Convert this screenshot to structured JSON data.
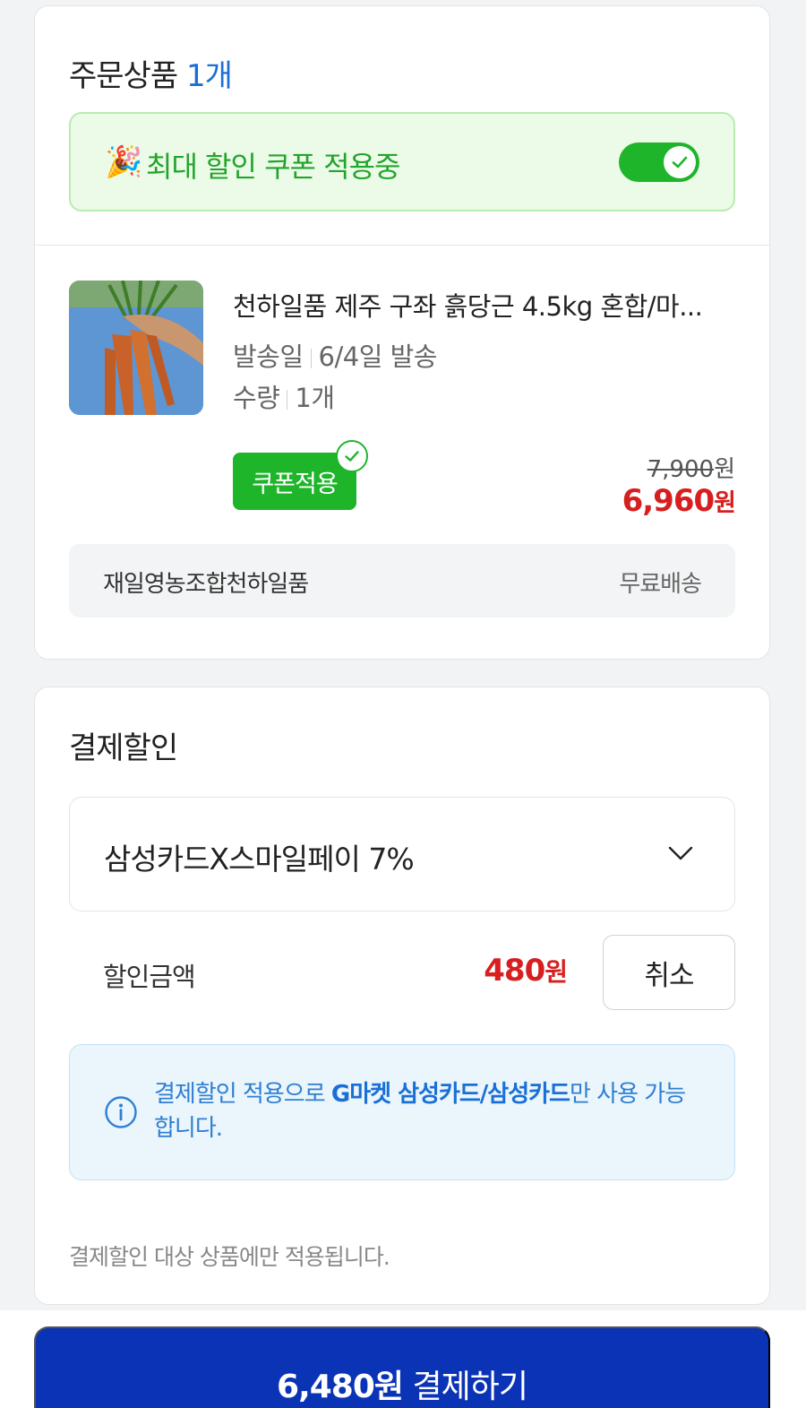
{
  "order": {
    "title": "주문상품",
    "count": "1개",
    "coupon_banner": {
      "emoji": "🎉",
      "text": "최대 할인 쿠폰 적용중",
      "toggle_on": true
    },
    "product": {
      "name": "천하일품 제주 구좌 흙당근 4.5kg 혼합/마...",
      "ship_label": "발송일",
      "ship_value": "6/4일 발송",
      "qty_label": "수량",
      "qty_value": "1개",
      "coupon_chip": "쿠폰적용",
      "price_original": "7,900",
      "price_original_unit": "원",
      "price_final": "6,960",
      "price_final_unit": "원"
    },
    "seller": {
      "name": "재일영농조합천하일품",
      "shipping": "무료배송"
    }
  },
  "payment": {
    "title": "결제할인",
    "selected_card": "삼성카드X스마일페이 7%",
    "discount_label": "할인금액",
    "discount_amount": "480",
    "discount_unit": "원",
    "cancel_label": "취소",
    "info_prefix": "결제할인 적용으로 ",
    "info_bold": "G마켓 삼성카드/삼성카드",
    "info_suffix": "만 사용 가능합니다.",
    "footnote": "결제할인 대상 상품에만 적용됩니다."
  },
  "checkout": {
    "amount": "6,480원",
    "label": " 결제하기"
  },
  "colors": {
    "accent_blue": "#1a6fd6",
    "green": "#1fb52b",
    "price_red": "#d71f1f",
    "pay_button": "#0b33b5"
  },
  "icons": [
    "party-popper-icon",
    "check-icon",
    "chevron-down-icon",
    "info-icon"
  ]
}
